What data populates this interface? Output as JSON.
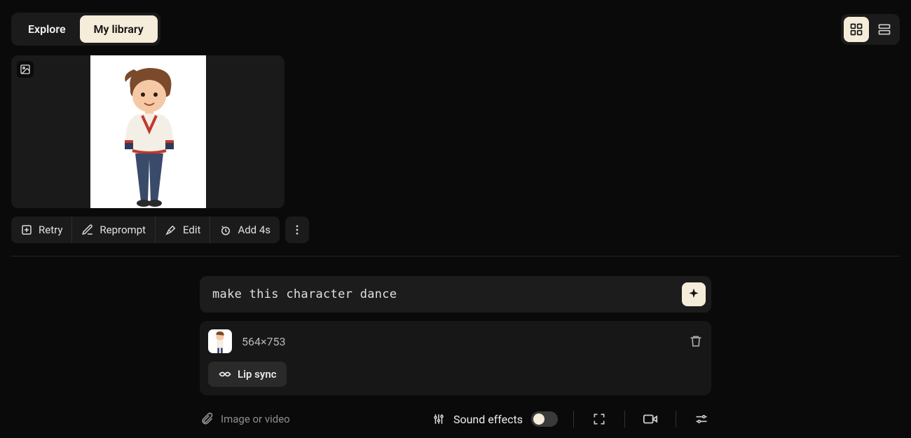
{
  "topbar": {
    "tabs": {
      "explore": "Explore",
      "my_library": "My library"
    },
    "view_icons": {
      "grid": "grid-icon",
      "list": "list-icon"
    }
  },
  "card": {
    "badge_icon": "image-icon"
  },
  "actions": {
    "retry": "Retry",
    "reprompt": "Reprompt",
    "edit": "Edit",
    "add4s": "Add 4s"
  },
  "prompt": {
    "text": "make this character dance",
    "sparkle_icon": "sparkle-icon"
  },
  "attachment": {
    "dimensions": "564×753",
    "lip_sync_label": "Lip sync"
  },
  "bottombar": {
    "attach_label": "Image or video",
    "sfx_label": "Sound effects"
  }
}
